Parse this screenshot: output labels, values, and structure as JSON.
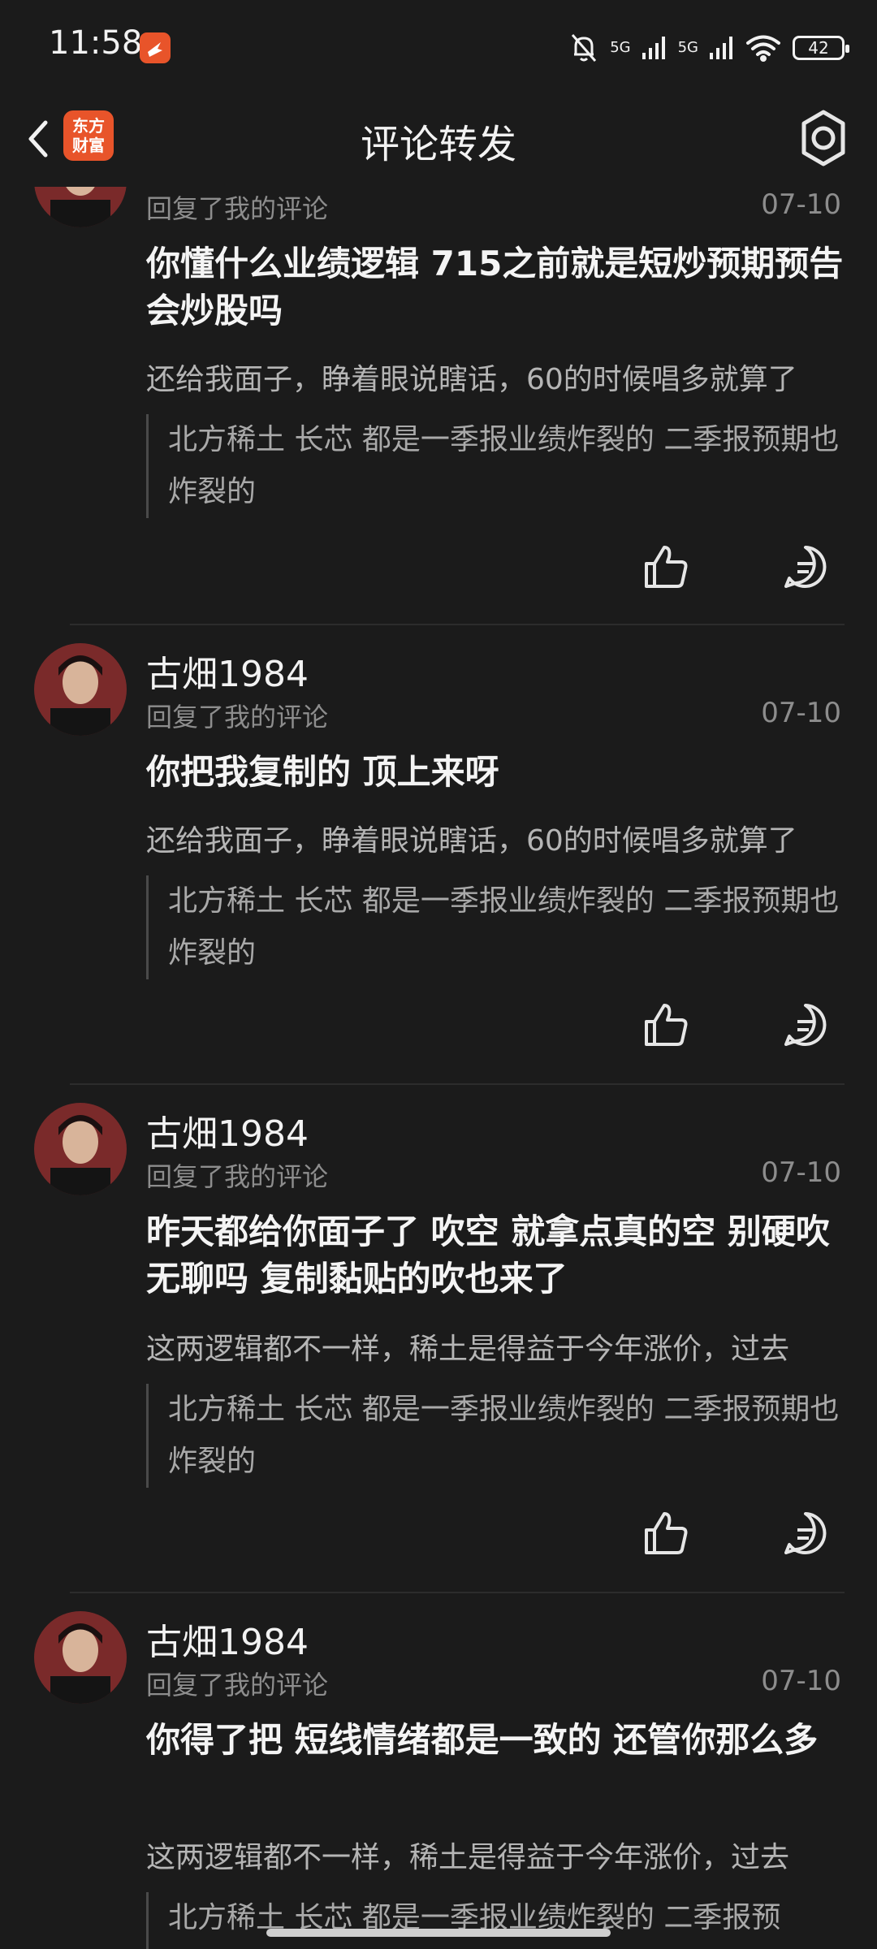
{
  "status_bar": {
    "time": "11:58",
    "network_1": "5G",
    "network_2": "5G",
    "battery": "42",
    "icons": [
      "mute-bell-icon",
      "signal-icon",
      "wifi-icon",
      "battery-icon"
    ]
  },
  "navbar": {
    "title": "评论转发",
    "logo_line1": "东方",
    "logo_line2": "财富",
    "icons": [
      "back-chevron-icon",
      "settings-gear-icon"
    ]
  },
  "comments": [
    {
      "username": "",
      "reply_label": "回复了我的评论",
      "date": "07-10",
      "content": "你懂什么业绩逻辑 715之前就是短炒预期预告 会炒股吗",
      "original": "还给我面子，睁着眼说瞎话，60的时候唱多就算了",
      "quote": "北方稀土 长芯 都是一季报业绩炸裂的 二季报预期也炸裂的"
    },
    {
      "username": "古畑1984",
      "reply_label": "回复了我的评论",
      "date": "07-10",
      "content": "你把我复制的 顶上来呀",
      "original": "还给我面子，睁着眼说瞎话，60的时候唱多就算了",
      "quote": "北方稀土 长芯 都是一季报业绩炸裂的 二季报预期也炸裂的"
    },
    {
      "username": "古畑1984",
      "reply_label": "回复了我的评论",
      "date": "07-10",
      "content": "昨天都给你面子了 吹空 就拿点真的空 别硬吹 无聊吗 复制黏贴的吹也来了",
      "original": "这两逻辑都不一样，稀土是得益于今年涨价，过去",
      "quote": "北方稀土 长芯 都是一季报业绩炸裂的 二季报预期也炸裂的"
    },
    {
      "username": "古畑1984",
      "reply_label": "回复了我的评论",
      "date": "07-10",
      "content": "你得了把 短线情绪都是一致的 还管你那么多",
      "original": "这两逻辑都不一样，稀土是得益于今年涨价，过去",
      "quote": "北方稀土 长芯 都是一季报业绩炸裂的 二季报预"
    }
  ],
  "colors": {
    "background": "#1b1b1b",
    "brand": "#e8542a",
    "text_primary": "#f4f4f4",
    "text_secondary": "#8d8d8d"
  }
}
